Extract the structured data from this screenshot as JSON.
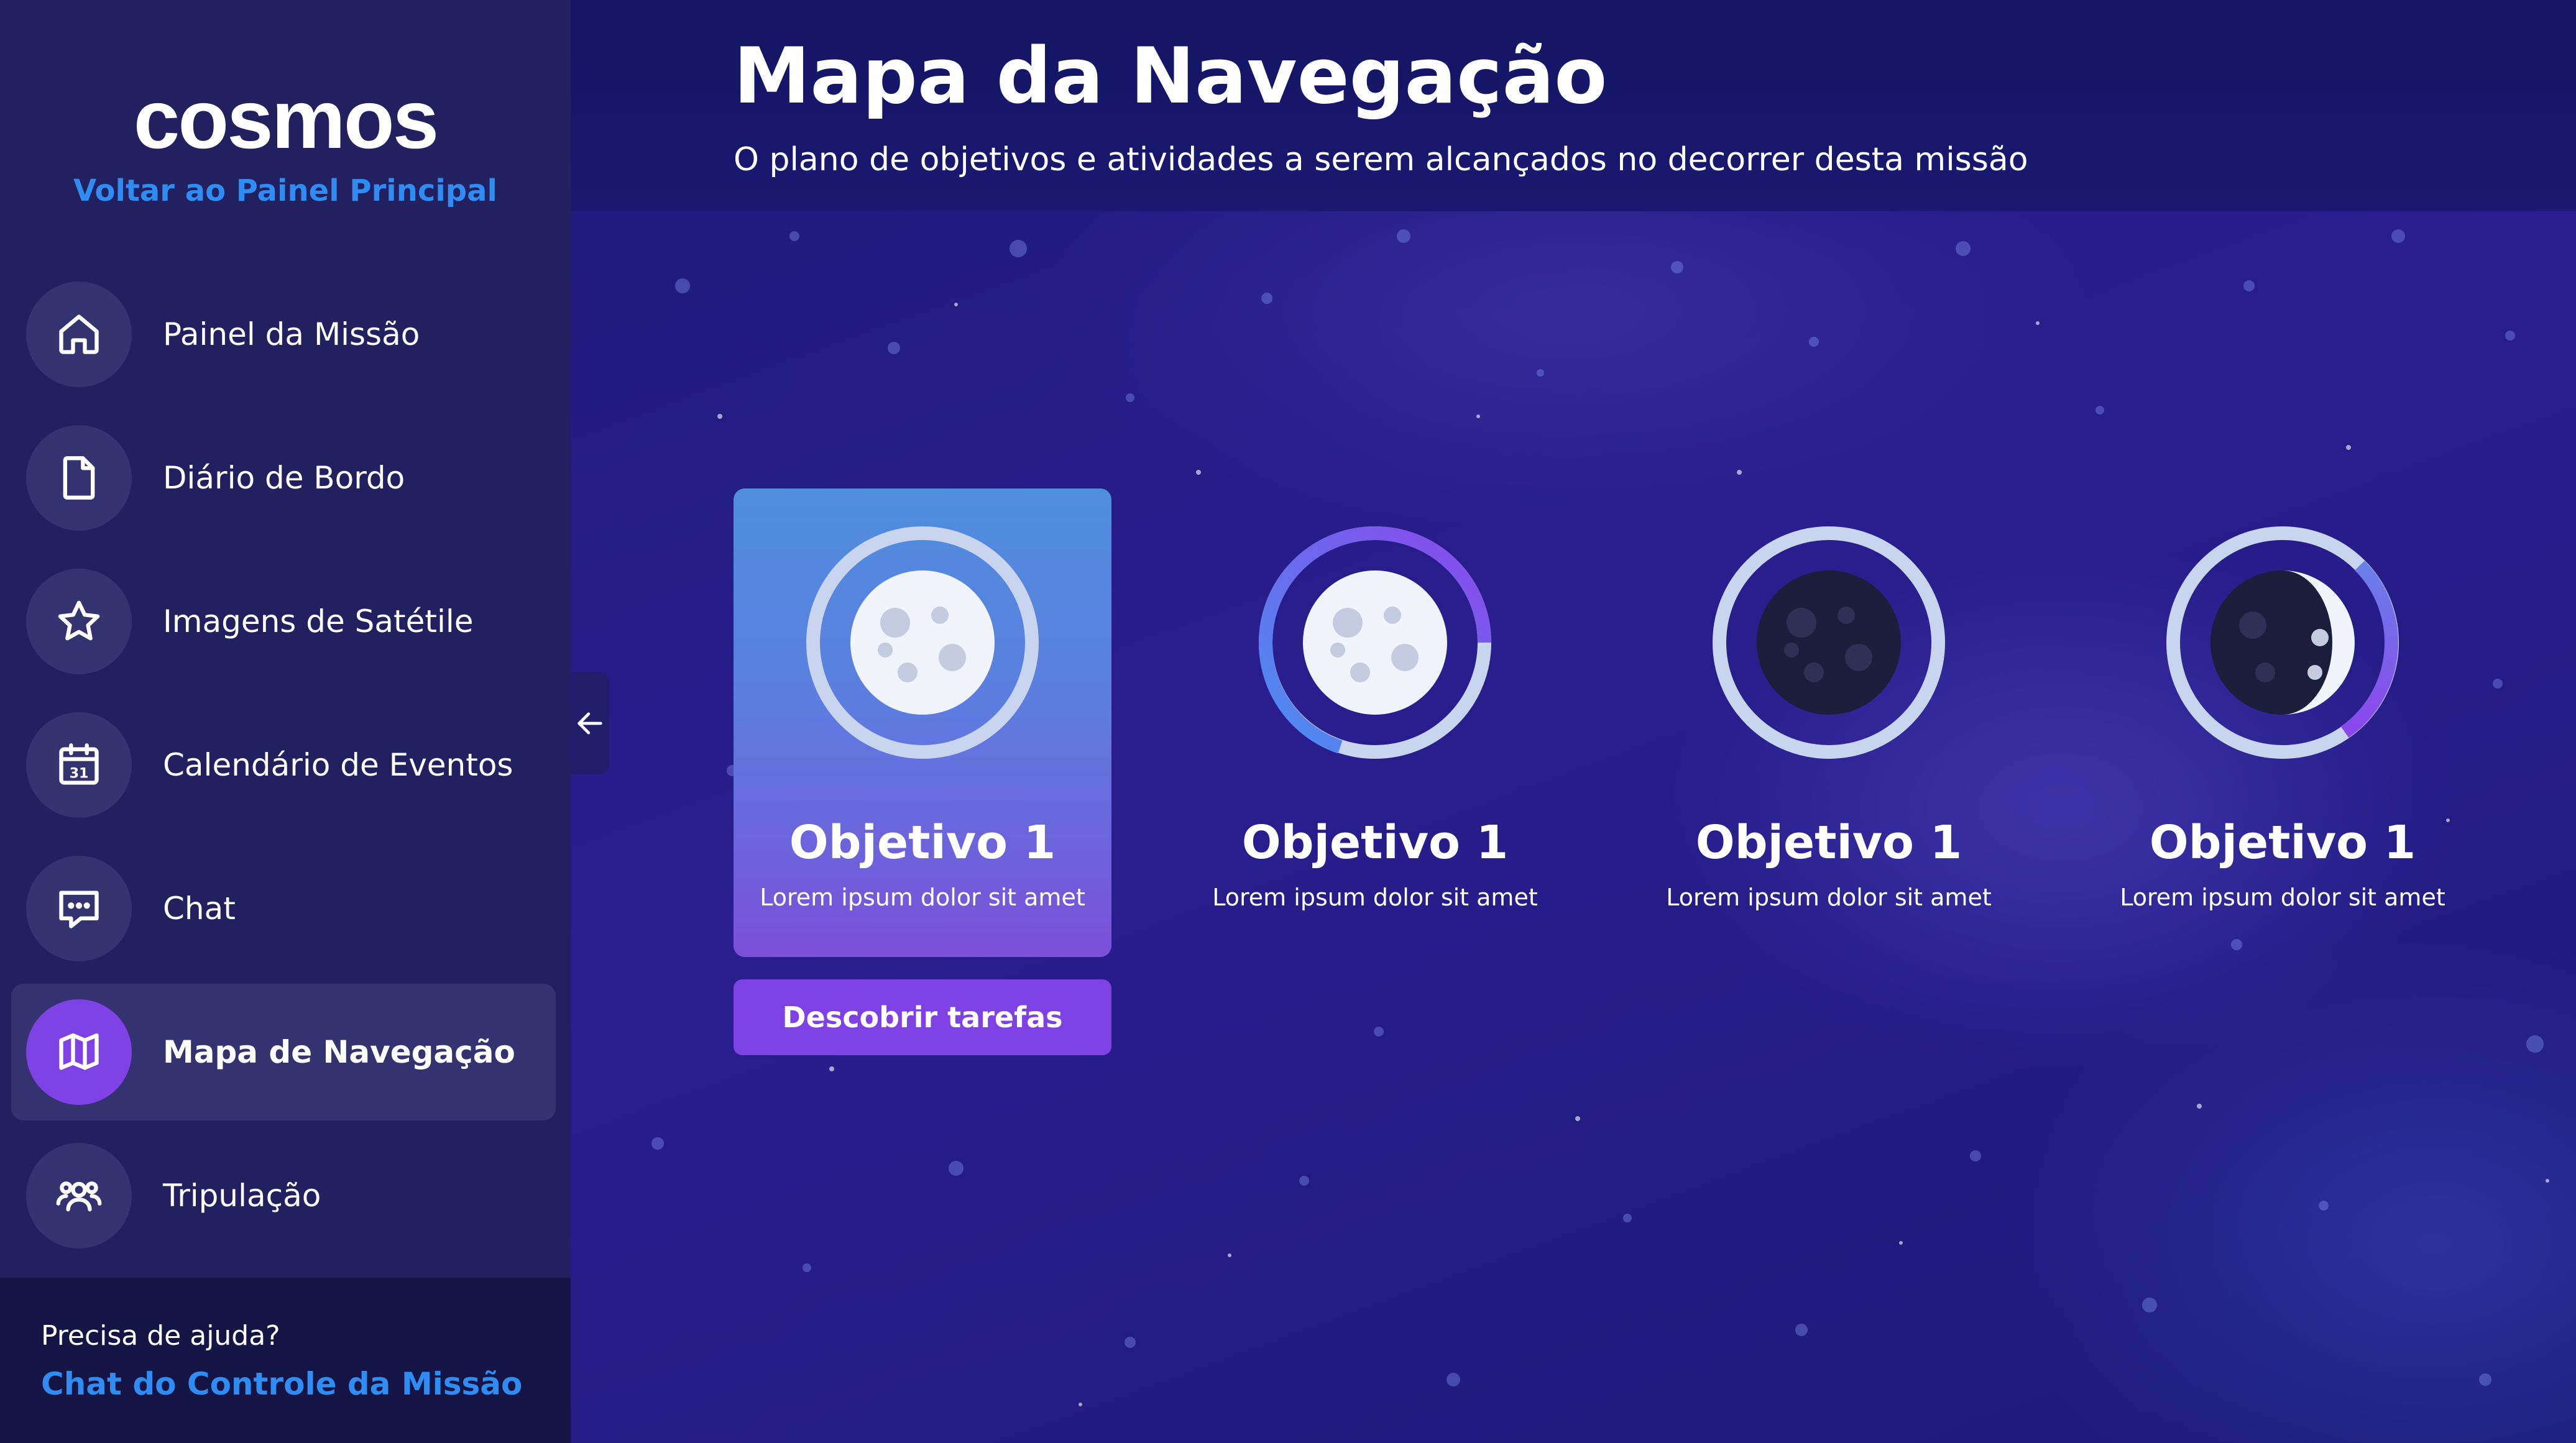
{
  "sidebar": {
    "logo": "cosmos",
    "back_link": "Voltar ao Painel Principal",
    "items": [
      {
        "label": "Painel da Missão",
        "icon": "home-icon"
      },
      {
        "label": "Diário de Bordo",
        "icon": "document-icon"
      },
      {
        "label": "Imagens de Satétile",
        "icon": "star-icon"
      },
      {
        "label": "Calendário de Eventos",
        "icon": "calendar-icon"
      },
      {
        "label": "Chat",
        "icon": "chat-icon"
      },
      {
        "label": "Mapa de Navegação",
        "icon": "map-icon",
        "active": true
      },
      {
        "label": "Tripulação",
        "icon": "users-icon"
      }
    ],
    "help_question": "Precisa de ajuda?",
    "help_link": "Chat do Controle da Missão",
    "calendar_day": "31"
  },
  "header": {
    "title": "Mapa da Navegação",
    "subtitle": "O plano de objetivos e atividades a serem alcançados no decorrer desta missão"
  },
  "objectives": [
    {
      "title": "Objetivo 1",
      "description": "Lorem ipsum dolor sit amet",
      "moon_phase": "full",
      "progress": 1.0,
      "selected": true
    },
    {
      "title": "Objetivo 1",
      "description": "Lorem ipsum dolor sit amet",
      "moon_phase": "full",
      "progress": 0.4,
      "selected": false
    },
    {
      "title": "Objetivo 1",
      "description": "Lorem ipsum dolor sit amet",
      "moon_phase": "new",
      "progress": 0.0,
      "selected": false
    },
    {
      "title": "Objetivo 1",
      "description": "Lorem ipsum dolor sit amet",
      "moon_phase": "first-quarter",
      "progress": 0.35,
      "selected": false
    }
  ],
  "actions": {
    "discover_button": "Descobrir tarefas"
  },
  "colors": {
    "accent": "#7e41e4",
    "link": "#2f8cf2",
    "sidebar_bg": "#22205e"
  }
}
